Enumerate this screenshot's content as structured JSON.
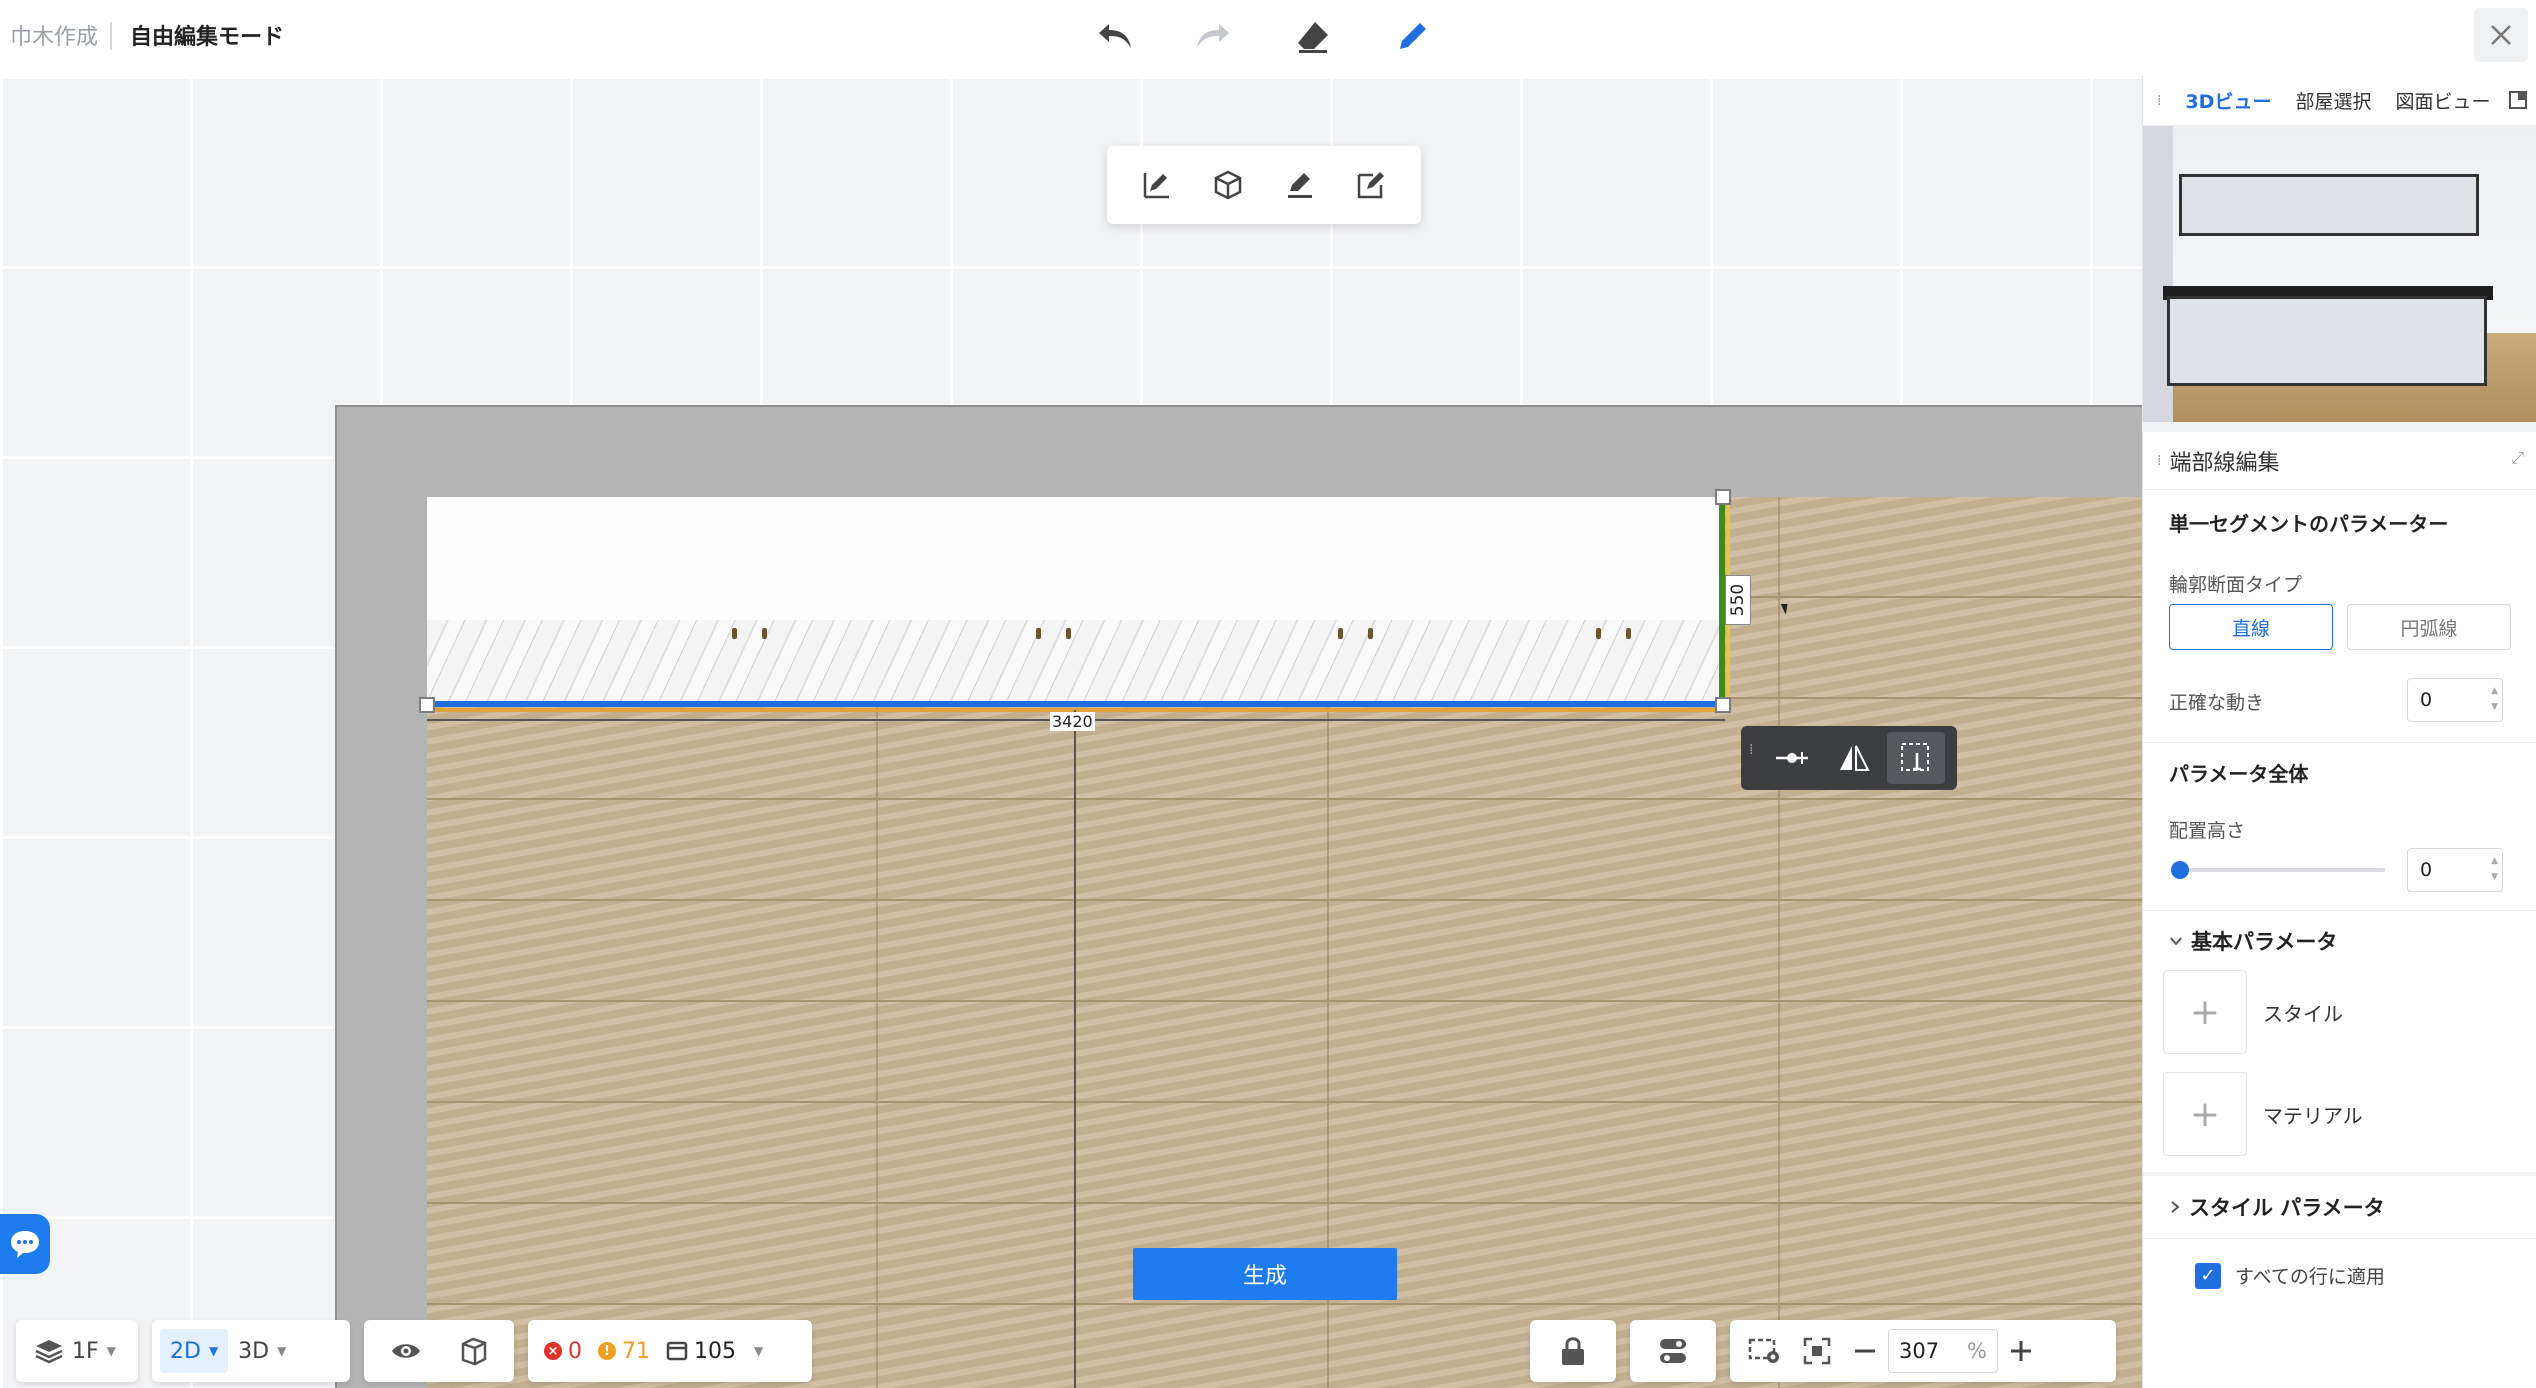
{
  "header": {
    "app_title": "巾木作成",
    "mode_title": "自由編集モード",
    "tools": [
      "undo-icon",
      "redo-icon",
      "eraser-icon",
      "pencil-icon"
    ]
  },
  "sub_toolbar": {
    "tools": [
      "draw-line-icon",
      "cube-icon",
      "edit-icon",
      "edit-box-icon"
    ]
  },
  "canvas": {
    "dimension_width": "3420",
    "dimension_height": "550",
    "generate_button": "生成"
  },
  "float_toolbar": {
    "tools": [
      "node-icon",
      "mirror-icon",
      "select-area-icon"
    ]
  },
  "preview_panel": {
    "tabs": [
      "3Dビュー",
      "部屋選択",
      "図面ビュー"
    ],
    "active_tab": "3Dビュー"
  },
  "edit_panel": {
    "title": "端部線編集",
    "segment_params_title": "単一セグメントのパラメーター",
    "profile_type_label": "輪郭断面タイプ",
    "profile_options": [
      "直線",
      "円弧線"
    ],
    "selected_profile": "直線",
    "precise_move_label": "正確な動き",
    "precise_move_value": "0",
    "global_params_title": "パラメータ全体",
    "height_label": "配置高さ",
    "height_value": "0",
    "height_fraction": 0,
    "basic_params_title": "基本パラメータ",
    "style_label": "スタイル",
    "material_label": "マテリアル",
    "style_params_title": "スタイル パラメータ",
    "apply_all_label": "すべての行に適用",
    "apply_all_checked": true
  },
  "bottom_bar": {
    "floor": "1F",
    "view_2d": "2D",
    "view_3d": "3D",
    "errors": "0",
    "warnings": "71",
    "items": "105",
    "zoom": "307",
    "zoom_unit": "%"
  },
  "colors": {
    "accent": "#1f6fe0",
    "error": "#e0322b",
    "warning": "#f0a020"
  }
}
